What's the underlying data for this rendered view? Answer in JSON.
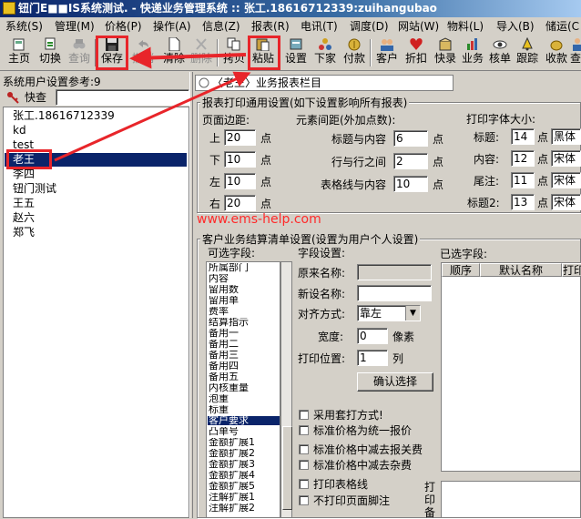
{
  "window": {
    "title": "钮门E■■IS系统测试.  - 快递业务管理系统  :: 张工.18616712339:zuihangubao"
  },
  "menu": [
    "系统(S)",
    "管理(M)",
    "价格(P)",
    "操作(A)",
    "信息(Z)",
    "报表(R)",
    "电讯(T)",
    "调度(D)",
    "网站(W)",
    "物料(L)",
    "导入(B)",
    "储运(C"
  ],
  "toolbar": [
    {
      "label": "主页",
      "icon": "home-icon",
      "disabled": false
    },
    {
      "label": "切换",
      "icon": "switch-icon",
      "disabled": false
    },
    {
      "label": "查询",
      "icon": "binoculars-icon",
      "disabled": true
    },
    {
      "label": "保存",
      "icon": "floppy-disk-icon",
      "disabled": false
    },
    {
      "label": "撤销",
      "icon": "undo-icon",
      "disabled": true
    },
    {
      "label": "清除",
      "icon": "blank-page-icon",
      "disabled": false
    },
    {
      "label": "删除",
      "icon": "delete-icon",
      "disabled": true
    },
    {
      "label": "拷贝",
      "icon": "copy-icon",
      "disabled": false
    },
    {
      "label": "粘贴",
      "icon": "paste-icon",
      "disabled": false
    },
    {
      "label": "设置",
      "icon": "settings-icon",
      "disabled": false
    },
    {
      "label": "下家",
      "icon": "network-icon",
      "disabled": false
    },
    {
      "label": "付款",
      "icon": "payment-icon",
      "disabled": false
    },
    {
      "label": "客户",
      "icon": "people-icon",
      "disabled": false
    },
    {
      "label": "折扣",
      "icon": "heart-icon",
      "disabled": false
    },
    {
      "label": "快录",
      "icon": "box-icon",
      "disabled": false
    },
    {
      "label": "业务",
      "icon": "chart-icon",
      "disabled": false
    },
    {
      "label": "核单",
      "icon": "eye-icon",
      "disabled": false
    },
    {
      "label": "跟踪",
      "icon": "bell-icon",
      "disabled": false
    },
    {
      "label": "收款",
      "icon": "coin-icon",
      "disabled": false
    },
    {
      "label": "查",
      "icon": "person-icon",
      "disabled": false
    }
  ],
  "left": {
    "title": "系统用户设置参考:9",
    "search_label": "快查",
    "search_value": "",
    "users": [
      "张工.18616712339",
      "kd",
      "test",
      "老王",
      "李四",
      "钮门测试",
      "王五",
      "赵六",
      "郑飞"
    ],
    "selected_index": 3
  },
  "report_bar": "〈老王〉业务报表栏目",
  "print_settings": {
    "title": "报表打印通用设置(如下设置影响所有报表)",
    "margins_title": "页面边距:",
    "margins": [
      {
        "label": "上",
        "value": "20",
        "unit": "点"
      },
      {
        "label": "下",
        "value": "10",
        "unit": "点"
      },
      {
        "label": "左",
        "value": "10",
        "unit": "点"
      },
      {
        "label": "右",
        "value": "20",
        "unit": "点"
      }
    ],
    "spacing_title": "元素间距(外加点数):",
    "spacing": [
      {
        "label": "标题与内容",
        "value": "6",
        "unit": "点"
      },
      {
        "label": "行与行之间",
        "value": "2",
        "unit": "点"
      },
      {
        "label": "表格线与内容",
        "value": "10",
        "unit": "点"
      }
    ],
    "font_title": "打印字体大小:",
    "fonts": [
      {
        "label": "标题:",
        "value": "14",
        "unit": "点",
        "font": "黑体"
      },
      {
        "label": "内容:",
        "value": "12",
        "unit": "点",
        "font": "宋体"
      },
      {
        "label": "尾注:",
        "value": "11",
        "unit": "点",
        "font": "宋体"
      },
      {
        "label": "标题2:",
        "value": "13",
        "unit": "点",
        "font": "宋体"
      }
    ]
  },
  "watermark": "www.ems-help.com",
  "column_settings": {
    "title": "客户业务结算清单设置(设置为用户个人设置)",
    "available_label": "可选字段:",
    "fields": [
      "所属部门",
      "内容",
      "留用数",
      "留用单",
      "费率",
      "结算指示",
      "备用一",
      "备用二",
      "备用三",
      "备用四",
      "备用五",
      "内核重量",
      "泡重",
      "标重",
      "客户要求",
      "凸单号",
      "金额扩展1",
      "金额扩展2",
      "金额扩展3",
      "金额扩展4",
      "金额扩展5",
      "注解扩展1",
      "注解扩展2"
    ],
    "selected_field": "客户要求",
    "field_settings_label": "字段设置:",
    "original_name_label": "原来名称:",
    "original_name_value": "",
    "new_name_label": "新设名称:",
    "new_name_value": "",
    "align_label": "对齐方式:",
    "align_value": "靠左",
    "width_label": "宽度:",
    "width_value": "0",
    "width_unit": "像素",
    "position_label": "打印位置:",
    "position_value": "1",
    "position_unit": "列",
    "confirm_label": "确认选择",
    "checkboxes": [
      "采用套打方式!",
      "标准价格为统一报价",
      "标准价格中减去报关费",
      "标准价格中减去杂费",
      "打印表格线",
      "不打印页面脚注"
    ],
    "selected_label": "已选字段:",
    "selected_columns": [
      "顺序",
      "默认名称",
      "打印"
    ],
    "print_side_label": "打印备"
  }
}
